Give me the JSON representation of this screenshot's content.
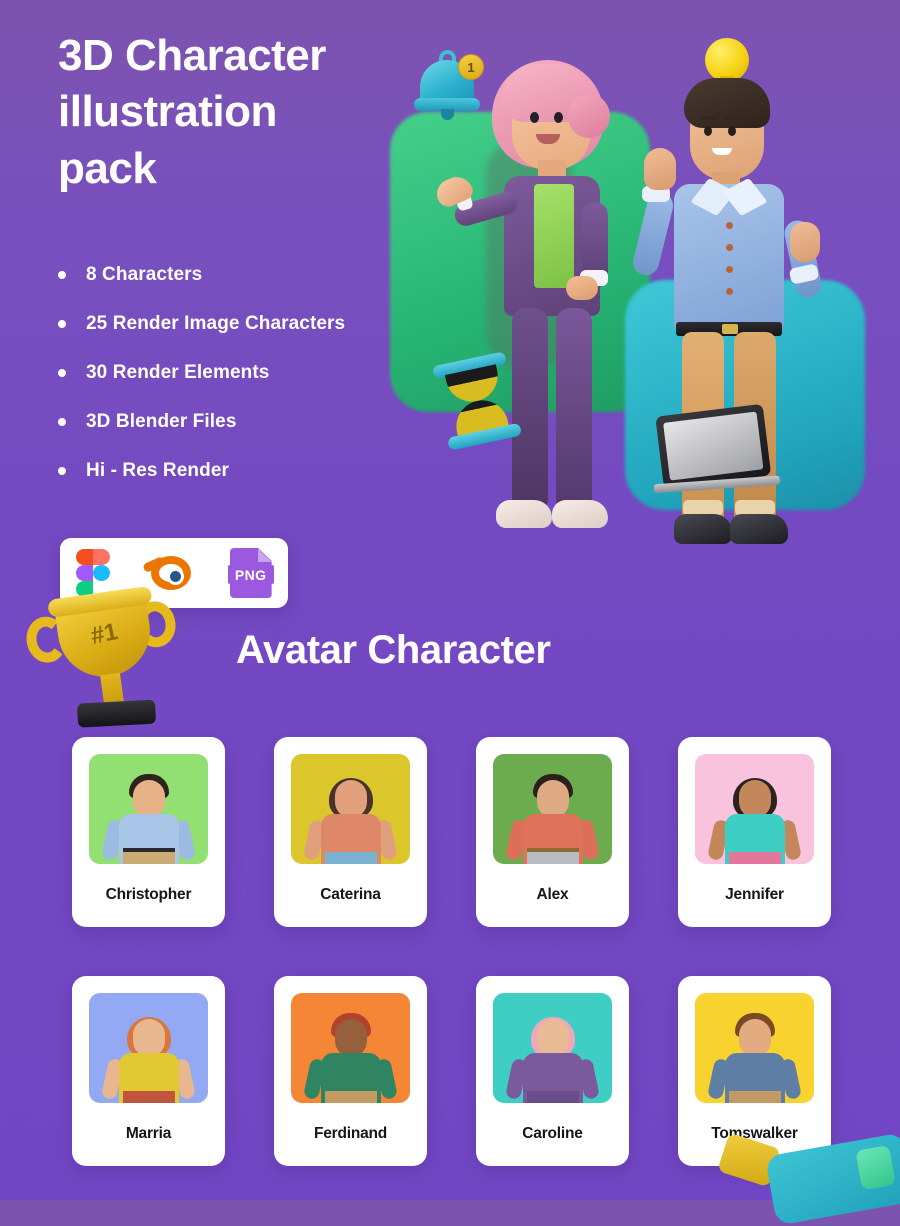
{
  "hero": {
    "title": "3D Character illustration pack",
    "title_lines": [
      "3D Character",
      "illustration",
      "pack"
    ],
    "features": [
      {
        "label": "8 Characters"
      },
      {
        "label": "25 Render Image Characters"
      },
      {
        "label": "30 Render Elements"
      },
      {
        "label": "3D Blender Files"
      },
      {
        "label": "Hi - Res Render"
      }
    ],
    "formats": [
      {
        "name": "figma-icon",
        "label": "Figma"
      },
      {
        "name": "blender-icon",
        "label": "Blender"
      },
      {
        "name": "png-icon",
        "label": "PNG"
      }
    ],
    "png_label": "PNG",
    "bell_badge": "1",
    "trophy_rank": "#1"
  },
  "section": {
    "title": "Avatar Character"
  },
  "avatars": [
    {
      "name": "Christopher",
      "bg": "#92df72",
      "skin": "#e8b288",
      "hair": "#2f241d",
      "top": "#a9c6e9",
      "sleeve": "#9cbbe2",
      "bottom": "#cbab74",
      "belt": true
    },
    {
      "name": "Caterina",
      "bg": "#dbc62c",
      "skin": "#e2a07c",
      "hair": "#4a332a",
      "top": "#de8769",
      "sleeve": "#e0a07c",
      "bottom": "#79b3cf",
      "belt": false
    },
    {
      "name": "Alex",
      "bg": "#6cac4e",
      "skin": "#deaa83",
      "hair": "#2b211a",
      "top": "#e0715a",
      "sleeve": "#dd6f58",
      "bottom": "#b8bcc0",
      "belt": true
    },
    {
      "name": "Jennifer",
      "bg": "#f9c3de",
      "skin": "#c4875c",
      "hair": "#2a2320",
      "top": "#3fcec4",
      "sleeve": "#c4875c",
      "bottom": "#e2769b",
      "belt": false
    },
    {
      "name": "Marria",
      "bg": "#93a9f4",
      "skin": "#e8b78f",
      "hair": "#d9763f",
      "top": "#e2c832",
      "sleeve": "#e8b78f",
      "bottom": "#c0553f",
      "belt": false
    },
    {
      "name": "Ferdinand",
      "bg": "#f58636",
      "skin": "#96603c",
      "hair": "#b0422f",
      "top": "#2f8561",
      "sleeve": "#2f8561",
      "bottom": "#c39a62",
      "belt": false
    },
    {
      "name": "Caroline",
      "bg": "#3fcec4",
      "skin": "#e8bb94",
      "hair": "#f0a7bd",
      "top": "#7a5a9c",
      "sleeve": "#7a5a9c",
      "bottom": "#6b4d8c",
      "belt": false
    },
    {
      "name": "Tomswalker",
      "bg": "#f8d22f",
      "skin": "#e2ab80",
      "hair": "#7a4a24",
      "top": "#5f7ea5",
      "sleeve": "#5f7ea5",
      "bottom": "#c49a63",
      "belt": false
    }
  ],
  "colors": {
    "background_purple": "#7449c2",
    "card_white": "#ffffff",
    "text_dark": "#15151a",
    "accent_green": "#27b473",
    "accent_teal": "#21a6bd",
    "accent_yellow": "#f5d312"
  }
}
